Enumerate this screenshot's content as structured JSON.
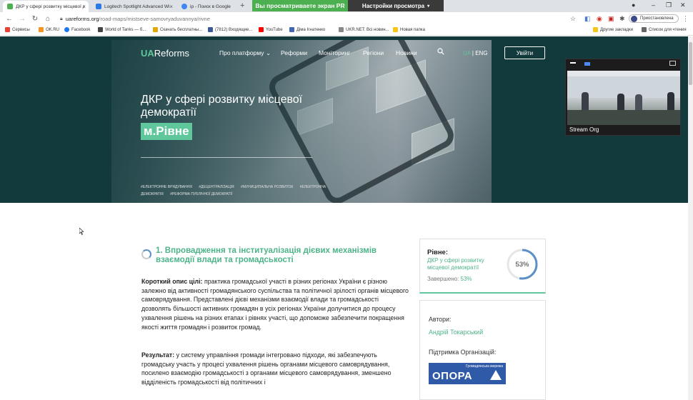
{
  "browser": {
    "tabs": [
      {
        "label": "ДКР у сфері розвитку місцевої д",
        "active": true,
        "color": "#4caf50"
      },
      {
        "label": "Logitech Spotlight Advanced Wi",
        "active": false,
        "color": "#2c7be5"
      },
      {
        "label": "ip - Поиск в Google",
        "active": false,
        "color": "#4285f4"
      }
    ],
    "new_tab": "+",
    "url_host": "uareforms.org",
    "url_path": "/road-maps/mistseve-samovryaduvannya/rivne",
    "profile_label": "Приостановлена",
    "share_banner_text": "Вы просматриваете экран PR",
    "share_settings_text": "Настройки просмотра",
    "bookmarks": [
      {
        "label": "Сервисы",
        "color": "#e94235"
      },
      {
        "label": "OK.RU",
        "color": "#f7931e"
      },
      {
        "label": "Facebook",
        "color": "#1877f2"
      },
      {
        "label": "World of Tanks — б...",
        "color": "#444"
      },
      {
        "label": "Скачать бесплатны...",
        "color": "#e0a800"
      },
      {
        "label": "(7812) Входящие...",
        "color": "#3d5a98"
      },
      {
        "label": "YouTube",
        "color": "#ff0000"
      },
      {
        "label": "Діма Ігнатенко",
        "color": "#4267b2"
      },
      {
        "label": "UKR.NET: Всі новин...",
        "color": "#888"
      },
      {
        "label": "Новая папка",
        "color": "#f5c518"
      }
    ],
    "bookmarks_right": [
      {
        "label": "Другие закладки",
        "color": "#f5c518"
      },
      {
        "label": "Список для чтения",
        "color": "#666"
      }
    ]
  },
  "site": {
    "logo_ua": "UA",
    "logo_rest": "Reforms",
    "nav": [
      "Про платформу",
      "Реформи",
      "Моніторинг",
      "Регіони",
      "Новини"
    ],
    "nav_dropdown_mark": "⌄",
    "lang_current": "UA",
    "lang_sep": " | ",
    "lang_other": "ENG",
    "login": "Увійти",
    "accent": "#5fc79b"
  },
  "hero": {
    "title": "ДКР у сфері розвитку місцевої демократії",
    "city": "м.Рівне",
    "tags": [
      "#ЕЛЕКТРОННЕ ВРЯДУВАННЯ",
      "#ДЕЦЕНТРАЛІЗАЦІЯ",
      "#МУНИЦИПАЛЬНА РОЗВИТОК",
      "#ЕЛЕКТРОННА ДЕМОКРАТІЯ",
      "#РЕФОРМА ПУБЛІЧНОЇ ДЕМОКРАТІЇ"
    ]
  },
  "video": {
    "label": "Stream Org"
  },
  "section": {
    "title": "1. Впровадження та інституалізація дієвих механізмів взаємодії влади та громадськості",
    "goal_label": "Короткий опис цілі:",
    "goal_text": " практика громадської участі в різних регіонах України є різною залежно від активності громадянського суспільства та політичної зрілості органів місцевого самоврядування. Представлені дієві механізми взаємодії влади та громадськості дозволять більшості активних громадян в усіх регіонах України долучитися до процесу ухвалення рішень на різних етапах і рівнях участі, що допоможе забезпечити покращення якості життя громадян і розвиток громад.",
    "result_label": "Результат:",
    "result_text": " у систему управління громади інтегровано підходи, які забезпечують громадську участь у процесі ухвалення рішень органами місцевого самоврядування, посилено взаємодію громадськості з органами місцевого самоврядування, зменшено відділеність громадськості від політичних і"
  },
  "card": {
    "city": "Рівне:",
    "subtitle": "ДКР у сфері розвитку місцевої демократії",
    "done_label": "Завершено: ",
    "done_value": "53%",
    "progress": 0.53,
    "ring_color": "#5c8fc5"
  },
  "authors": {
    "label": "Автори:",
    "name": "Андрій Токарський",
    "support_label": "Підтримка Організацій:",
    "org_small": "Громадянська мережа",
    "org_name": "ОПОРА"
  }
}
